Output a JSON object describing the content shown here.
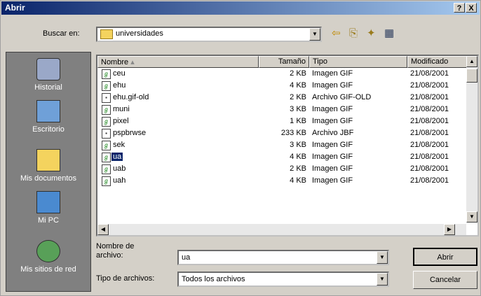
{
  "window": {
    "title": "Abrir",
    "help_label": "?",
    "close_label": "X"
  },
  "lookin": {
    "label": "Buscar en:",
    "value": "universidades"
  },
  "places": [
    {
      "label": "Historial",
      "icon": "history-icon"
    },
    {
      "label": "Escritorio",
      "icon": "desktop-icon"
    },
    {
      "label": "Mis documentos",
      "icon": "my-documents-icon"
    },
    {
      "label": "Mi PC",
      "icon": "my-computer-icon"
    },
    {
      "label": "Mis sitios de red",
      "icon": "network-places-icon"
    }
  ],
  "columns": {
    "name": "Nombre",
    "size": "Tamaño",
    "type": "Tipo",
    "modified": "Modificado"
  },
  "files": [
    {
      "name": "ceu",
      "size": "2 KB",
      "type": "Imagen GIF",
      "modified": "21/08/2001"
    },
    {
      "name": "ehu",
      "size": "4 KB",
      "type": "Imagen GIF",
      "modified": "21/08/2001"
    },
    {
      "name": "ehu.gif-old",
      "size": "2 KB",
      "type": "Archivo GIF-OLD",
      "modified": "21/08/2001"
    },
    {
      "name": "muni",
      "size": "3 KB",
      "type": "Imagen GIF",
      "modified": "21/08/2001"
    },
    {
      "name": "pixel",
      "size": "1 KB",
      "type": "Imagen GIF",
      "modified": "21/08/2001"
    },
    {
      "name": "pspbrwse",
      "size": "233 KB",
      "type": "Archivo JBF",
      "modified": "21/08/2001"
    },
    {
      "name": "sek",
      "size": "3 KB",
      "type": "Imagen GIF",
      "modified": "21/08/2001"
    },
    {
      "name": "ua",
      "size": "4 KB",
      "type": "Imagen GIF",
      "modified": "21/08/2001"
    },
    {
      "name": "uab",
      "size": "2 KB",
      "type": "Imagen GIF",
      "modified": "21/08/2001"
    },
    {
      "name": "uah",
      "size": "4 KB",
      "type": "Imagen GIF",
      "modified": "21/08/2001"
    }
  ],
  "filename": {
    "label_line1": "Nombre de",
    "label_line2": "archivo:",
    "value": "ua"
  },
  "filetype": {
    "label": "Tipo de archivos:",
    "value": "Todos los archivos"
  },
  "buttons": {
    "open": "Abrir",
    "cancel": "Cancelar"
  }
}
